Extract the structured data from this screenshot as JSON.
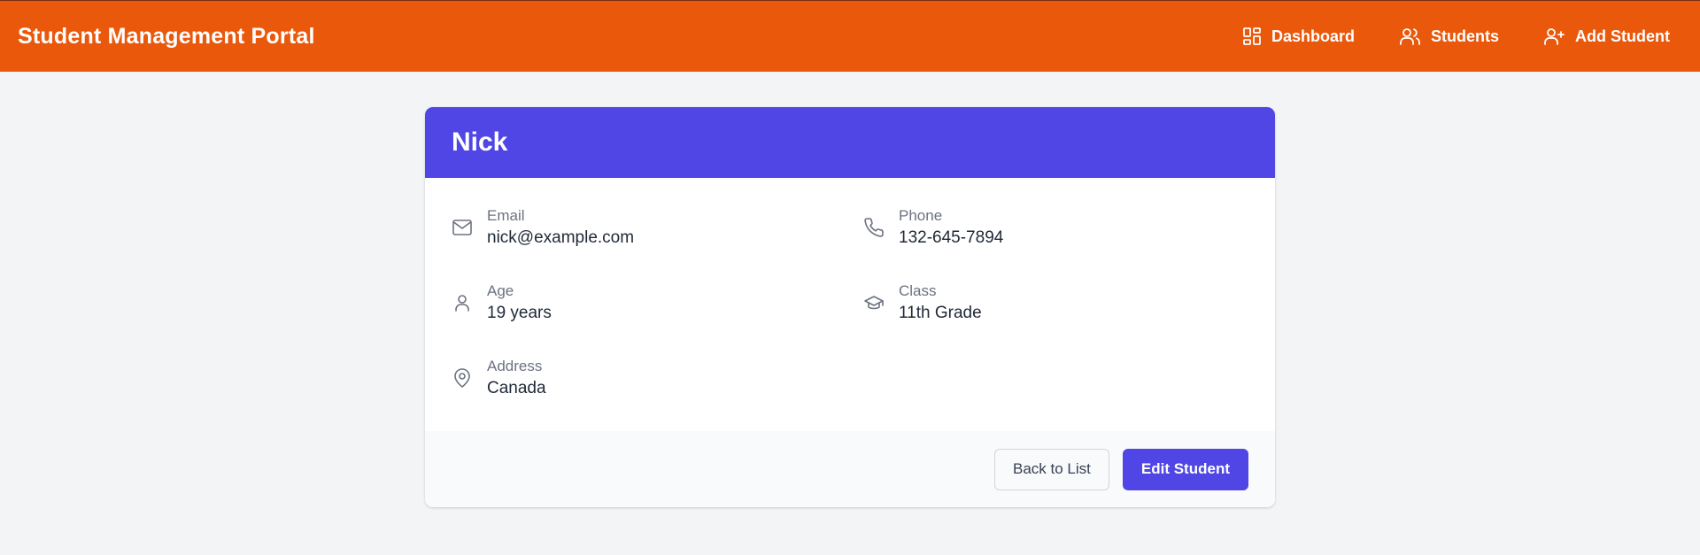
{
  "header": {
    "title": "Student Management Portal",
    "nav": [
      {
        "label": "Dashboard",
        "icon": "dashboard-icon"
      },
      {
        "label": "Students",
        "icon": "users-icon"
      },
      {
        "label": "Add Student",
        "icon": "user-plus-icon"
      }
    ]
  },
  "student": {
    "name": "Nick",
    "fields": {
      "email": {
        "label": "Email",
        "value": "nick@example.com",
        "icon": "mail-icon"
      },
      "phone": {
        "label": "Phone",
        "value": "132-645-7894",
        "icon": "phone-icon"
      },
      "age": {
        "label": "Age",
        "value": "19 years",
        "icon": "user-icon"
      },
      "class": {
        "label": "Class",
        "value": "11th Grade",
        "icon": "graduation-cap-icon"
      },
      "address": {
        "label": "Address",
        "value": "Canada",
        "icon": "map-pin-icon"
      }
    }
  },
  "actions": {
    "back_label": "Back to List",
    "edit_label": "Edit Student"
  },
  "colors": {
    "header_bg": "#ea580c",
    "card_header_bg": "#4f46e5",
    "primary_button": "#4f46e5",
    "page_bg": "#f3f4f6"
  }
}
